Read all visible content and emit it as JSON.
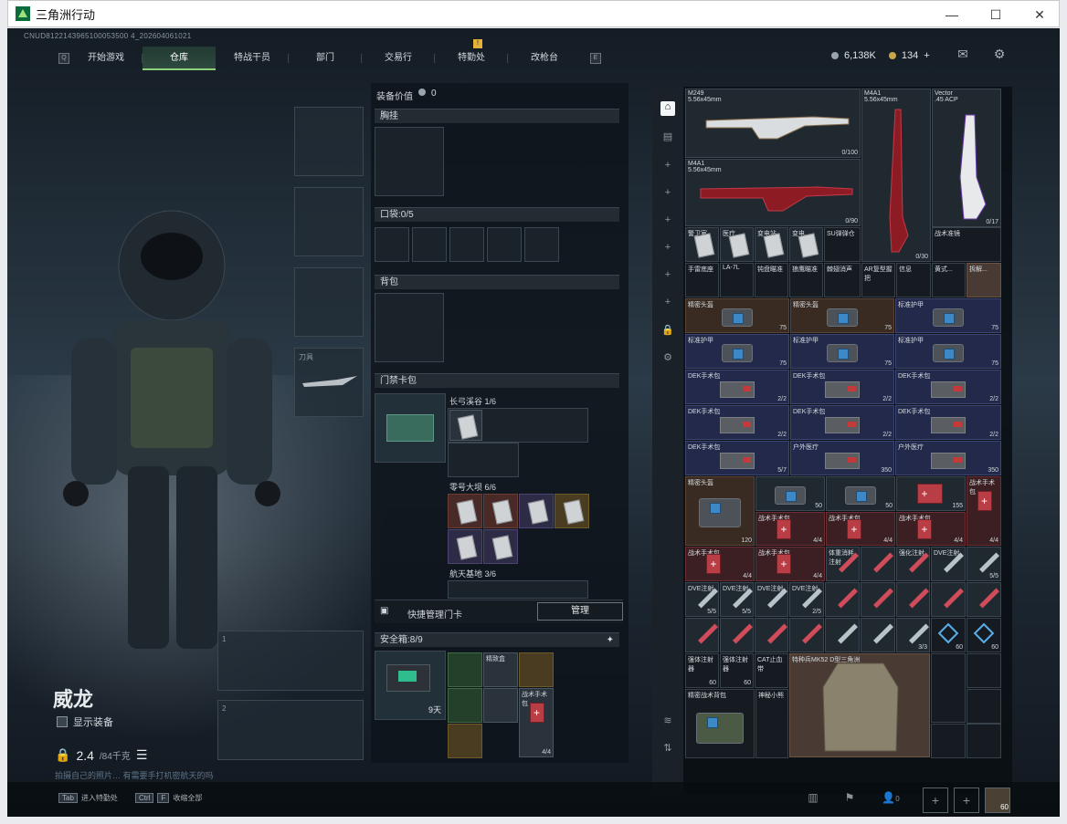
{
  "window": {
    "title": "三角洲行动",
    "minimize": "—",
    "maximize": "☐",
    "close": "✕"
  },
  "session_id": "CNUD8122143965100053500 4_202604061021",
  "nav": {
    "left_key": "Q",
    "right_key": "E",
    "tabs": [
      "开始游戏",
      "仓库",
      "特战干员",
      "部门",
      "交易行",
      "特勤处",
      "改枪台"
    ],
    "active_tab": 1,
    "alert": "!"
  },
  "currency": {
    "silver": "6,138K",
    "gold": "134",
    "plus": "+"
  },
  "character": {
    "name": "威龙",
    "show_equipment": "显示装备",
    "weight": "2.4",
    "weight_max": "/84千克",
    "tip": "拍摄自己的照片… 有需要手打机密航天的吗"
  },
  "equipment": {
    "melee_label": "刀具",
    "value_label": "装备价值",
    "value": "0",
    "chest_rig": "胸挂",
    "pockets": "口袋:",
    "pockets_count": "0",
    "pockets_max": "/5",
    "backpack": "背包",
    "keycard": "门禁卡包",
    "keycard_groups": [
      {
        "name": "长弓溪谷",
        "count": "1/6"
      },
      {
        "name": "零号大坝",
        "count": "6/6"
      },
      {
        "name": "航天基地",
        "count": "3/6"
      }
    ],
    "quick_manage": "快捷管理门卡",
    "manage_btn": "管理",
    "safebox_label": "安全箱:",
    "safebox_count": "8",
    "safebox_max": "/9",
    "safebox_days": "9天",
    "weapon_slot_1": "1",
    "weapon_slot_2": "2",
    "safebox_items": [
      {
        "label": "",
        "color": "green"
      },
      {
        "label": "精致盒",
        "color": "dark"
      },
      {
        "label": "",
        "color": "gold"
      },
      {
        "label": "",
        "color": "green"
      },
      {
        "label": "",
        "color": "dark"
      },
      {
        "label": "战术手术包",
        "color": "dark",
        "count": "4/4"
      },
      {
        "label": "",
        "color": "gold"
      }
    ]
  },
  "warehouse": {
    "title": "仓库",
    "weapons": [
      {
        "name": "M249",
        "caliber": "5.56x45mm",
        "ammo": "0/100"
      },
      {
        "name": "M4A1",
        "caliber": "5.56x45mm",
        "ammo": "0/90"
      },
      {
        "name": "Vector",
        "caliber": ".45 ACP",
        "ammo": "0/17"
      },
      {
        "name": "M4A1",
        "caliber": "5.56x45mm",
        "ammo": "0/30"
      }
    ],
    "row_small_1": [
      "警卫室",
      "医疗...",
      "变电站",
      "变电..."
    ],
    "suppressor": "SU弹弹仓",
    "scope": "战术准镜",
    "row_small_2": [
      "手雷底座",
      "LA-7L",
      "钝盘瞄准",
      "狼鹰瞄准",
      "棘翅消声",
      "AR复型握把",
      "信息",
      "黄式...",
      "拆解..."
    ],
    "helmets_label": "精密头盔",
    "armor_label": "标准护甲",
    "dek_label": "DEK手术包",
    "field_label": "户外医疗",
    "medic_labels": [
      "战术手术包",
      "体重消耗注射",
      "强化注射",
      "DVE注射"
    ],
    "counts": {
      "v75": "75",
      "k50": "50",
      "k350": "350",
      "k120": "120",
      "k155": "155",
      "k60": "60",
      "c22": "2/2",
      "c44": "4/4",
      "c55": "5/5",
      "c33": "3/3",
      "c57": "5/7",
      "c25": "2/5"
    },
    "bottom_items": [
      "强体注射器",
      "强体注射器",
      "CAT止血带",
      "特种兵MK52 D型三角洲",
      "精密战术背包",
      "神秘小熊",
      "",
      ""
    ]
  },
  "bottom": {
    "tab_key": "Tab",
    "tab_label": "进入特勤处",
    "ctrl_key": "Ctrl",
    "f_key": "F",
    "ctrl_label": "收缩全部",
    "friends": "0",
    "level": "60"
  }
}
